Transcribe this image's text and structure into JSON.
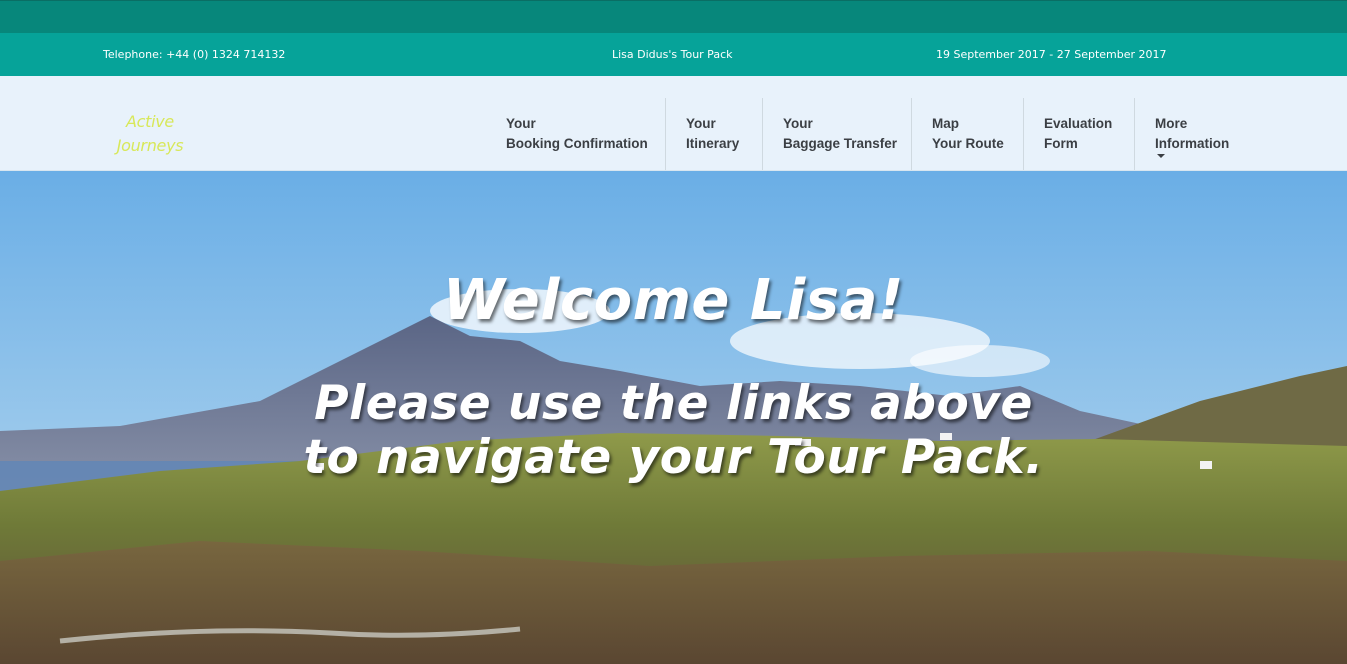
{
  "info_bar": {
    "telephone": "Telephone: +44 (0) 1324 714132",
    "pack_title": "Lisa Didus's Tour Pack",
    "dates": "19 September 2017 - 27 September 2017"
  },
  "logo": {
    "line1": "Active",
    "line2": "Journeys",
    "color": "#d8e85a"
  },
  "nav": {
    "items": [
      {
        "line1": "Your",
        "line2": "Booking Confirmation"
      },
      {
        "line1": "Your",
        "line2": "Itinerary"
      },
      {
        "line1": "Your",
        "line2": "Baggage Transfer"
      },
      {
        "line1": "Map",
        "line2": "Your Route"
      },
      {
        "line1": "Evaluation",
        "line2": "Form"
      },
      {
        "line1": "More",
        "line2": "Information",
        "has_dropdown": true
      }
    ]
  },
  "hero": {
    "welcome": "Welcome Lisa!",
    "instruction": "Please use the links above to navigate your Tour Pack."
  },
  "colors": {
    "top_strip": "#07877b",
    "info_bar": "#06a399",
    "nav_bg": "#e8f2fb",
    "nav_text": "#3b3f44"
  }
}
